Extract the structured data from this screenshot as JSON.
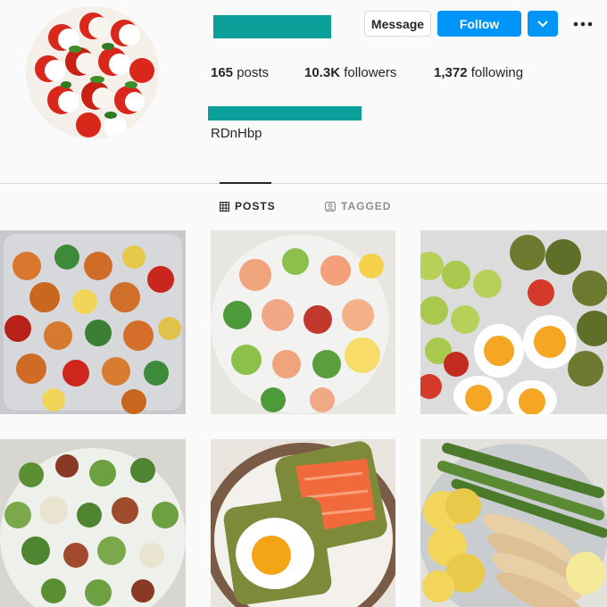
{
  "profile": {
    "bio_text": "RDnHbp",
    "avatar_icon": "caprese-salad-avatar"
  },
  "actions": {
    "message_label": "Message",
    "follow_label": "Follow",
    "dropdown_icon": "chevron-down-icon",
    "more_icon": "more-horizontal-icon"
  },
  "stats": {
    "posts_count": "165",
    "posts_label": "posts",
    "followers_count": "10.3K",
    "followers_label": "followers",
    "following_count": "1,372",
    "following_label": "following"
  },
  "tabs": [
    {
      "label": "POSTS",
      "icon": "grid-icon",
      "active": true
    },
    {
      "label": "TAGGED",
      "icon": "tag-icon",
      "active": false
    }
  ],
  "posts": [
    {
      "icon": "shrimp-vegetable-sheet-pan-image"
    },
    {
      "icon": "shrimp-avocado-salad-image"
    },
    {
      "icon": "egg-avocado-zucchini-plate-image"
    },
    {
      "icon": "broccoli-bacon-salad-image"
    },
    {
      "icon": "salmon-egg-avocado-toast-image"
    },
    {
      "icon": "chicken-asparagus-zucchini-plate-image"
    }
  ],
  "colors": {
    "accent": "#0095f6",
    "redacted": "#0b9f9a",
    "background": "#fafafa",
    "border": "#dbdbdb"
  }
}
